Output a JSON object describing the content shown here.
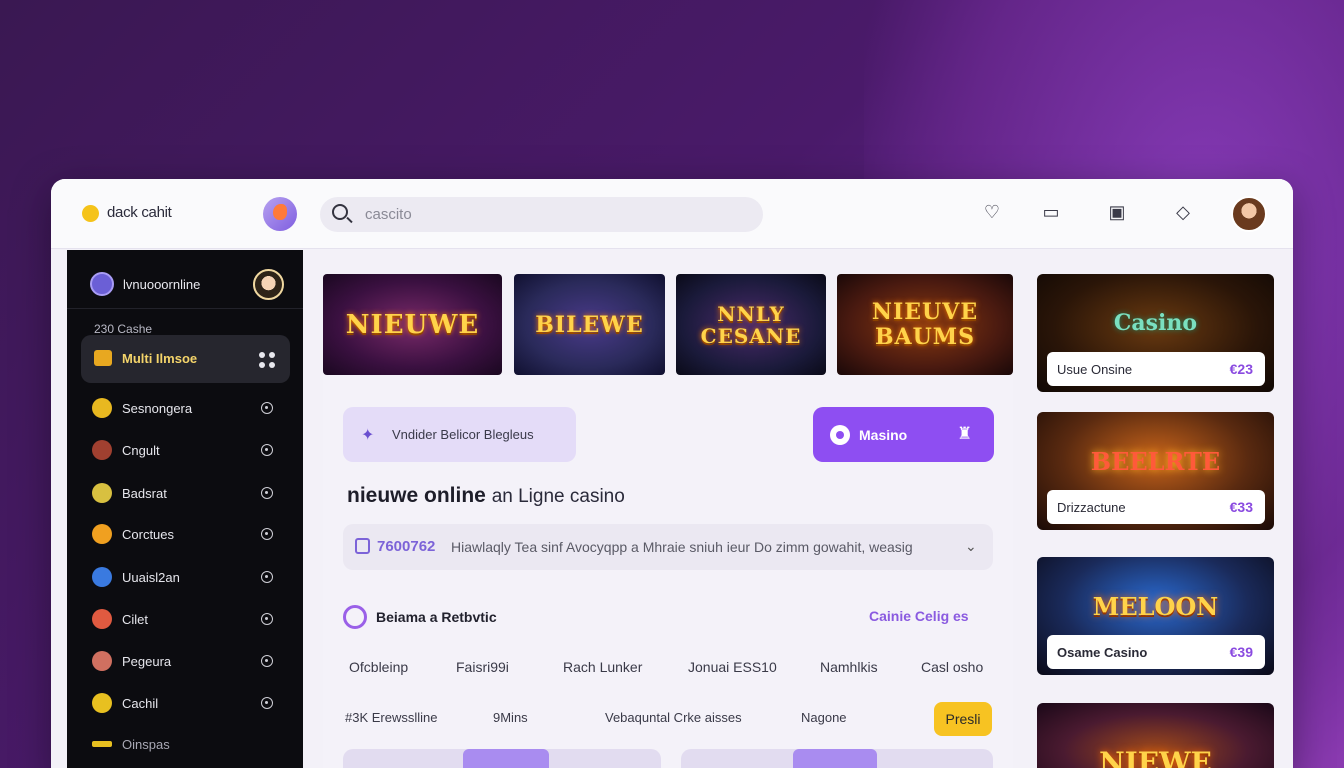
{
  "header": {
    "brand": "dack cahit",
    "search_placeholder": "cascito"
  },
  "sidebar": {
    "user": "lvnuooornline",
    "section": "230 Cashe",
    "active": "Multi Ilmsoe",
    "items": [
      {
        "label": "Sesnongera",
        "color": "#e8b820"
      },
      {
        "label": "Cngult",
        "color": "#a04030"
      },
      {
        "label": "Badsrat",
        "color": "#d8c040"
      },
      {
        "label": "Corctues",
        "color": "#f0a020"
      },
      {
        "label": "Uuaisl2an",
        "color": "#3a7ae0"
      },
      {
        "label": "Cilet",
        "color": "#e05a40"
      },
      {
        "label": "Pegeura",
        "color": "#d07060"
      },
      {
        "label": "Cachil",
        "color": "#e8c020"
      },
      {
        "label": "Oinspas",
        "color": "#e8c020"
      }
    ]
  },
  "banners": [
    {
      "title": "NIEUWE",
      "bg": "#3a1040"
    },
    {
      "title": "BILEWE",
      "bg": "#2a2a5a"
    },
    {
      "title": "NNLY CESANE",
      "bg": "#1a1a3a"
    },
    {
      "title": "NIEUVE BAUMS",
      "bg": "#4a1a10"
    }
  ],
  "main": {
    "chip": "Vndider Belicor Blegleus",
    "primary_button": "Masino",
    "title_bold": "nieuwe online",
    "title_rest": "an Ligne casino",
    "info_number": "7600762",
    "info_text": "Hiawlaqly Tea sinf Avocyqpp a Mhraie sniuh ieur Do zimm gowahit, weasig",
    "section_title": "Beiama a Retbvtic",
    "section_link": "Cainie Celig es",
    "filters_row1": [
      "Ofcbleinp",
      "Faisri99i",
      "Rach Lunker",
      "Jonuai ESS10",
      "Namhlkis",
      "Casl osho"
    ],
    "filters_row2": [
      "#3K Erewsslline",
      "9Mins",
      "Vebaquntal Crke aisses",
      "Nagone"
    ],
    "yellow_button": "Presli"
  },
  "right_cards": [
    {
      "title": "Casino",
      "name": "Usue Onsine",
      "price": "€23"
    },
    {
      "title": "BEELRTE",
      "name": "Drizzactune",
      "price": "€33"
    },
    {
      "title": "MELOON",
      "name": "Osame Casino",
      "price": "€39"
    },
    {
      "title": "NIEWE",
      "name": "",
      "price": ""
    }
  ],
  "colors": {
    "accent": "#8e4ef2",
    "gold": "#f7c322"
  }
}
